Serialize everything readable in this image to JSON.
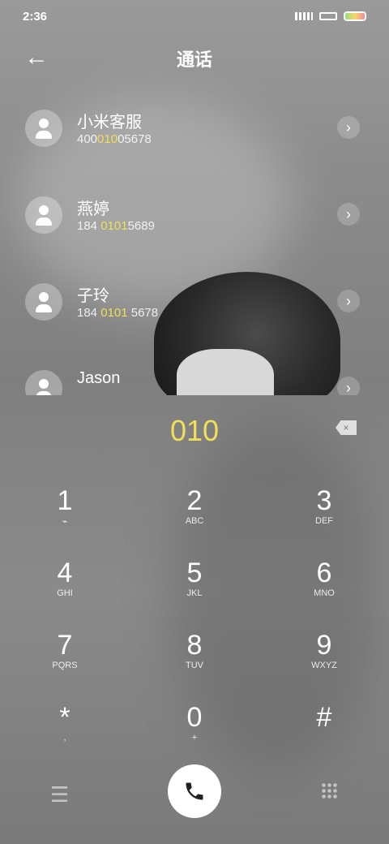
{
  "status": {
    "time": "2:36",
    "signal_icon": "signal-bars-icon",
    "wifi_icon": "wifi-icon",
    "battery_icon": "battery-icon"
  },
  "header": {
    "back_icon": "back-arrow-icon",
    "title": "通话"
  },
  "contacts": [
    {
      "name": "小米客服",
      "number_parts": [
        "400",
        "010",
        "05678"
      ]
    },
    {
      "name": "燕婷",
      "number_parts": [
        "184 ",
        "0101",
        "5689"
      ]
    },
    {
      "name": "子玲",
      "number_parts": [
        "184 ",
        "0101",
        " 5678"
      ]
    },
    {
      "name": "Jason",
      "number_parts": [
        "",
        "",
        ""
      ]
    }
  ],
  "dial": {
    "digits": "010",
    "delete_icon": "backspace-icon"
  },
  "keypad": [
    {
      "digit": "1",
      "letters": "⌁"
    },
    {
      "digit": "2",
      "letters": "ABC"
    },
    {
      "digit": "3",
      "letters": "DEF"
    },
    {
      "digit": "4",
      "letters": "GHI"
    },
    {
      "digit": "5",
      "letters": "JKL"
    },
    {
      "digit": "6",
      "letters": "MNO"
    },
    {
      "digit": "7",
      "letters": "PQRS"
    },
    {
      "digit": "8",
      "letters": "TUV"
    },
    {
      "digit": "9",
      "letters": "WXYZ"
    },
    {
      "digit": "*",
      "letters": ","
    },
    {
      "digit": "0",
      "letters": "+"
    },
    {
      "digit": "#",
      "letters": ""
    }
  ],
  "bottom": {
    "menu_icon": "menu-icon",
    "call_icon": "phone-icon",
    "keypad_icon": "keypad-grid-icon"
  }
}
